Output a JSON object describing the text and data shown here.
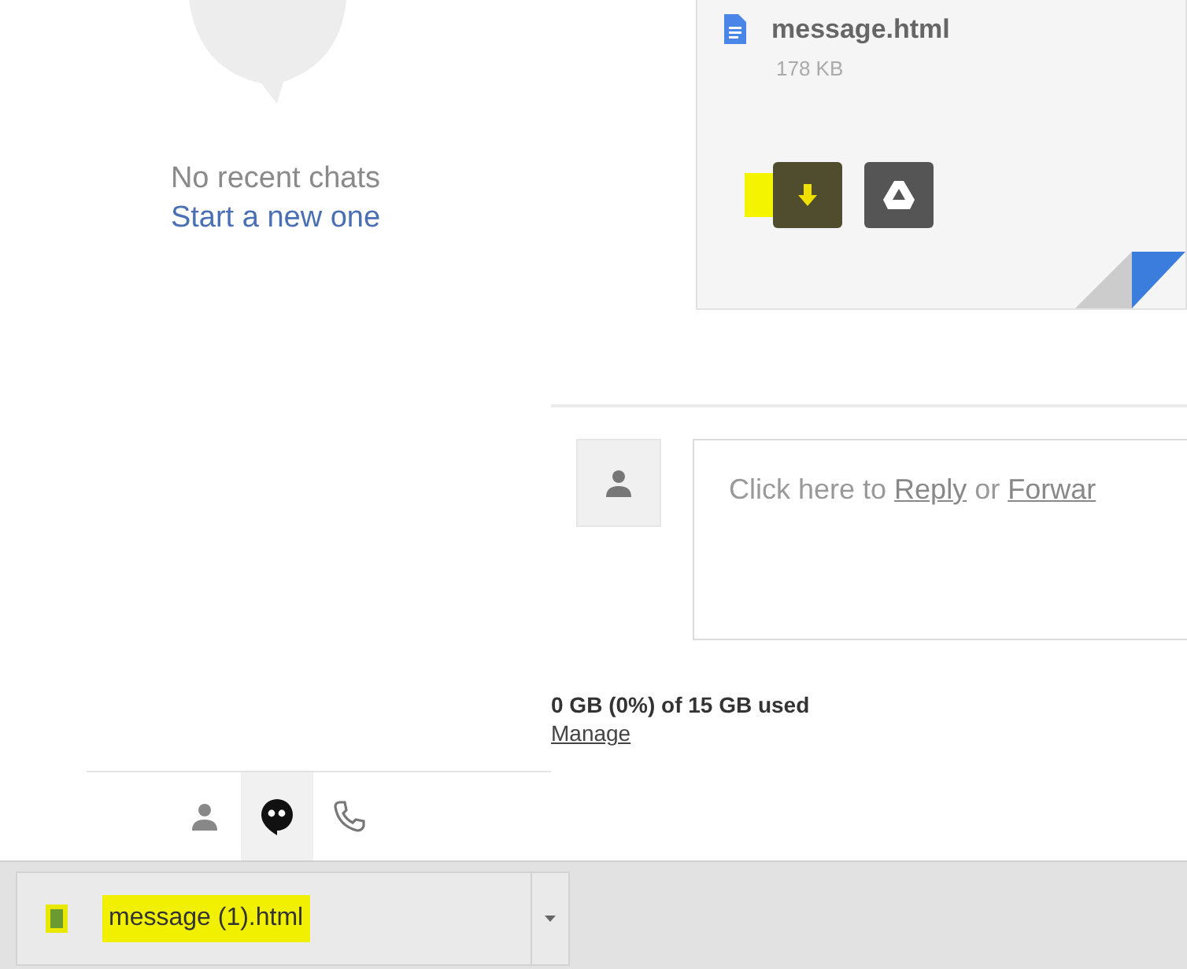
{
  "chat_panel": {
    "empty_text": "No recent chats",
    "start_link": "Start a new one",
    "tabs": [
      {
        "kind": "person",
        "selected": false
      },
      {
        "kind": "hangouts",
        "selected": true
      },
      {
        "kind": "phone",
        "selected": false
      }
    ]
  },
  "attachment": {
    "name": "message.html",
    "size": "178 KB",
    "actions": [
      {
        "kind": "download",
        "highlighted": true
      },
      {
        "kind": "drive",
        "highlighted": false
      }
    ]
  },
  "reply": {
    "parts": [
      {
        "kind": "text",
        "text": "Click here to "
      },
      {
        "kind": "link",
        "text": "Reply"
      },
      {
        "kind": "text",
        "text": " or "
      },
      {
        "kind": "link",
        "text": "Forwar"
      }
    ]
  },
  "storage": {
    "usage": "0 GB (0%) of 15 GB used",
    "manage_link": "Manage"
  },
  "download_bar": {
    "items": [
      {
        "name": "message (1).html",
        "highlighted": true
      }
    ]
  }
}
